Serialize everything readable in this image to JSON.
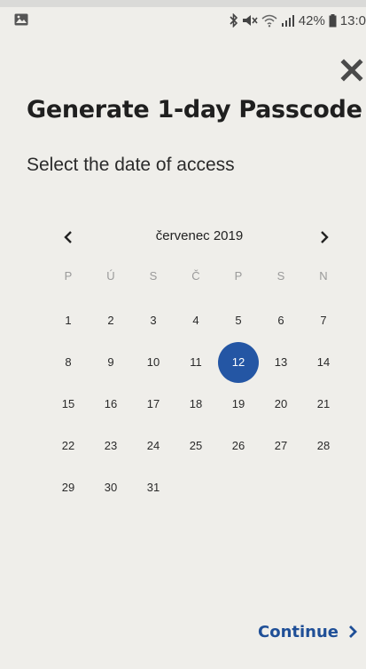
{
  "status_bar": {
    "battery_percent": "42%",
    "time": "13:0"
  },
  "dialog": {
    "title": "Generate 1-day Passcode",
    "subtitle": "Select the date of access",
    "continue_label": "Continue"
  },
  "calendar": {
    "month_label": "červenec 2019",
    "weekdays": [
      "P",
      "Ú",
      "S",
      "Č",
      "P",
      "S",
      "N"
    ],
    "selected_day": "12",
    "weeks": [
      [
        "1",
        "2",
        "3",
        "4",
        "5",
        "6",
        "7"
      ],
      [
        "8",
        "9",
        "10",
        "11",
        "12",
        "13",
        "14"
      ],
      [
        "15",
        "16",
        "17",
        "18",
        "19",
        "20",
        "21"
      ],
      [
        "22",
        "23",
        "24",
        "25",
        "26",
        "27",
        "28"
      ],
      [
        "29",
        "30",
        "31",
        "",
        "",
        "",
        ""
      ]
    ]
  },
  "colors": {
    "accent": "#2456a4",
    "continue_text": "#1f4f97",
    "background": "#efeeea"
  },
  "icons": {
    "close": "close-icon",
    "prev_month": "chevron-left-icon",
    "next_month": "chevron-right-icon",
    "continue": "chevron-right-icon"
  }
}
